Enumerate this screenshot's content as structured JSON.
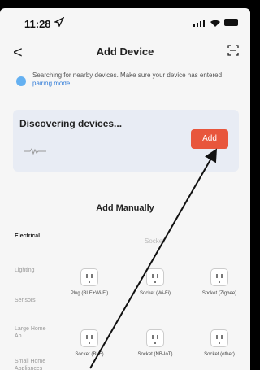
{
  "status_bar": {
    "time": "11:28"
  },
  "nav": {
    "back_label": "<",
    "title": "Add Device"
  },
  "search_hint": {
    "text": "Searching for nearby devices. Make sure your device has entered",
    "link": "pairing mode."
  },
  "discover": {
    "title": "Discovering devices...",
    "add_label": "Add"
  },
  "manual": {
    "title": "Add Manually",
    "group_label": "Socket",
    "categories": [
      "Electrical",
      "Lighting",
      "Sensors",
      "Large Home Ap...",
      "Small Home Appliances"
    ],
    "devices": [
      {
        "label": "Plug (BLE+Wi-Fi)"
      },
      {
        "label": "Socket (Wi-Fi)"
      },
      {
        "label": "Socket (Zigbee)"
      },
      {
        "label": "Socket (BLE)"
      },
      {
        "label": "Socket (NB-IoT)"
      },
      {
        "label": "Socket (other)"
      }
    ]
  },
  "colors": {
    "accent": "#e8563c",
    "link": "#2f7bd8",
    "card": "#e8ecf4"
  }
}
